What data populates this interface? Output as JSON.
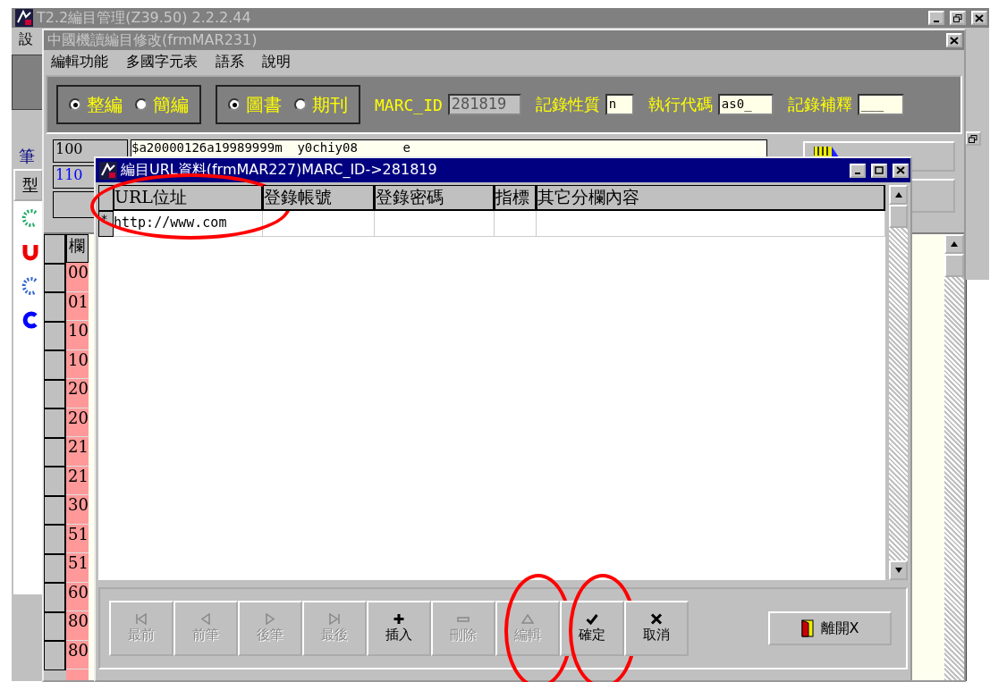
{
  "app_window": {
    "title": "T2.2編目管理(Z39.50) 2.2.2.44",
    "menu": [
      "設"
    ],
    "side_label": "筆",
    "side_tab": "型"
  },
  "editor_window": {
    "title": "中國機讀編目修改(frmMAR231)",
    "menu": [
      "編輯功能",
      "多國字元表",
      "語系",
      "說明"
    ],
    "radio_groups": [
      [
        {
          "label": "整編",
          "selected": true
        },
        {
          "label": "簡編",
          "selected": false
        }
      ],
      [
        {
          "label": "圖書",
          "selected": true
        },
        {
          "label": "期刊",
          "selected": false
        }
      ]
    ],
    "fields": [
      {
        "label": "MARC_ID",
        "value": "281819",
        "disabled": true
      },
      {
        "label": "記錄性質",
        "value": "n",
        "disabled": false
      },
      {
        "label": "執行代碼",
        "value": "as0_",
        "disabled": false
      },
      {
        "label": "記錄補釋",
        "value": "___",
        "disabled": false
      }
    ],
    "header_lines": [
      {
        "tag": "100",
        "value": "$a20000126a19989999m  y0chiy08      e",
        "color": "#000000"
      },
      {
        "tag": "110",
        "color": "#0000ff"
      }
    ],
    "table": {
      "column_1": "欄",
      "rows": [
        "00",
        "01",
        "10",
        "10",
        "20",
        "20",
        "21",
        "21",
        "30",
        "51",
        "51",
        "60",
        "80",
        "80"
      ]
    }
  },
  "url_dialog": {
    "title": "編目URL資料(frmMAR227)MARC_ID->281819",
    "columns": [
      {
        "label": "URL位址",
        "highlighted": true
      },
      {
        "label": "登錄帳號",
        "highlighted": false
      },
      {
        "label": "登錄密碼",
        "highlighted": false
      },
      {
        "label": "指標",
        "highlighted": false
      },
      {
        "label": "其它分欄內容",
        "highlighted": false
      }
    ],
    "rows": [
      {
        "marker": "*",
        "cells": [
          "http://www.com"
        ]
      }
    ],
    "buttons": [
      {
        "label": "最前",
        "kind": "first",
        "disabled": true,
        "highlighted": false
      },
      {
        "label": "前筆",
        "kind": "prev",
        "disabled": true,
        "highlighted": false
      },
      {
        "label": "後筆",
        "kind": "next",
        "disabled": true,
        "highlighted": false
      },
      {
        "label": "最後",
        "kind": "last",
        "disabled": true,
        "highlighted": false
      },
      {
        "label": "插入",
        "kind": "plus",
        "disabled": false,
        "highlighted": false
      },
      {
        "label": "刪除",
        "kind": "minus",
        "disabled": true,
        "highlighted": false
      },
      {
        "label": "編輯",
        "kind": "up",
        "disabled": true,
        "highlighted": true
      },
      {
        "label": "確定",
        "kind": "check",
        "disabled": false,
        "highlighted": true
      },
      {
        "label": "取消",
        "kind": "cross",
        "disabled": false,
        "highlighted": false
      }
    ],
    "exit_button": {
      "label": "離開X"
    }
  }
}
